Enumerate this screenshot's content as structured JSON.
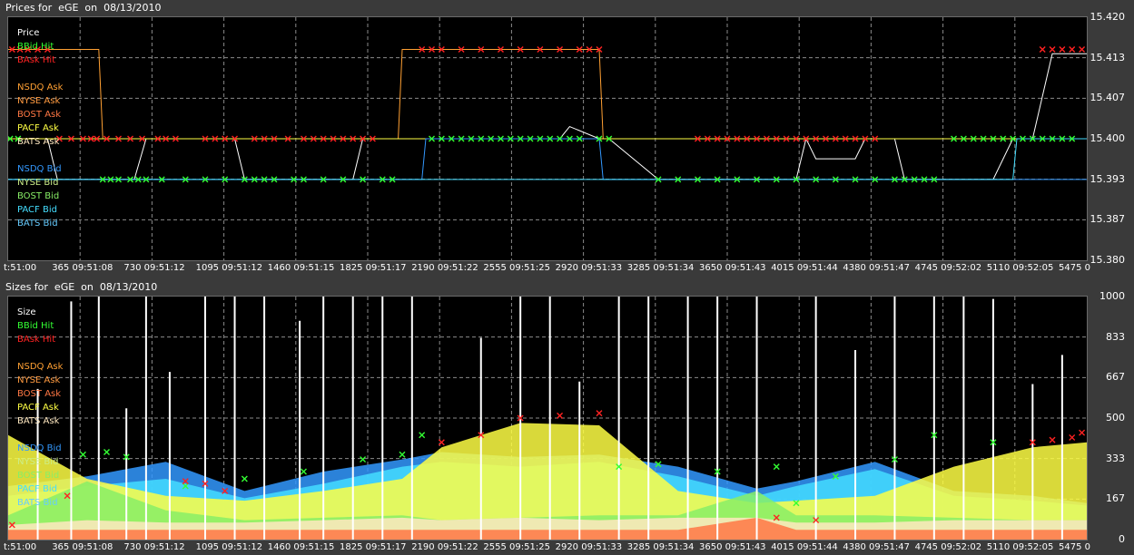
{
  "top": {
    "title": "Prices for  eGE  on  08/13/2010",
    "y_ticks": [
      "15.420",
      "15.413",
      "15.407",
      "15.400",
      "15.393",
      "15.387",
      "15.380"
    ],
    "x_ticks": [
      "t:51:00",
      "365 09:51:08",
      "730 09:51:12",
      "1095 09:51:12",
      "1460 09:51:15",
      "1825 09:51:17",
      "2190 09:51:22",
      "2555 09:51:25",
      "2920 09:51:33",
      "3285 09:51:34",
      "3650 09:51:43",
      "4015 09:51:44",
      "4380 09:51:47",
      "4745 09:52:02",
      "5110 09:52:05",
      "5475 0"
    ],
    "legend": [
      {
        "label": "Price",
        "color": "#ffffff"
      },
      {
        "label": "BBid Hit",
        "color": "#33ff33"
      },
      {
        "label": "BAsk Hit",
        "color": "#ff2222"
      },
      {
        "label": "",
        "color": ""
      },
      {
        "label": "NSDQ Ask",
        "color": "#ffa033"
      },
      {
        "label": "NYSE Ask",
        "color": "#ff9a40"
      },
      {
        "label": "BOST Ask",
        "color": "#ff7744"
      },
      {
        "label": "PACF Ask",
        "color": "#ffff44"
      },
      {
        "label": "BATS Ask",
        "color": "#ffe8c0"
      },
      {
        "label": "",
        "color": ""
      },
      {
        "label": "NSDQ Bid",
        "color": "#3399ff"
      },
      {
        "label": "NYSE Bid",
        "color": "#ccee88"
      },
      {
        "label": "BOST Bid",
        "color": "#88ee66"
      },
      {
        "label": "PACF Bid",
        "color": "#44ddff"
      },
      {
        "label": "BATS Bid",
        "color": "#66ccff"
      }
    ]
  },
  "bottom": {
    "title": "Sizes for  eGE  on  08/13/2010",
    "y_ticks": [
      "1000",
      "833",
      "667",
      "500",
      "333",
      "167",
      "0"
    ],
    "x_ticks": [
      "t:51:00",
      "365 09:51:08",
      "730 09:51:12",
      "1095 09:51:12",
      "1460 09:51:15",
      "1825 09:51:17",
      "2190 09:51:22",
      "2555 09:51:25",
      "2920 09:51:33",
      "3285 09:51:34",
      "3650 09:51:43",
      "4015 09:51:44",
      "4380 09:51:47",
      "4745 09:52:02",
      "5110 09:52:05",
      "5475 0"
    ],
    "legend": [
      {
        "label": "Size",
        "color": "#ffffff"
      },
      {
        "label": "BBid Hit",
        "color": "#33ff33"
      },
      {
        "label": "BAsk Hit",
        "color": "#ff2222"
      },
      {
        "label": "",
        "color": ""
      },
      {
        "label": "NSDQ Ask",
        "color": "#ffa033"
      },
      {
        "label": "NYSE Ask",
        "color": "#ff9a40"
      },
      {
        "label": "BOST Ask",
        "color": "#ff7744"
      },
      {
        "label": "PACF Ask",
        "color": "#ffff44"
      },
      {
        "label": "BATS Ask",
        "color": "#ffe8c0"
      },
      {
        "label": "",
        "color": ""
      },
      {
        "label": "NSDQ Bid",
        "color": "#3399ff"
      },
      {
        "label": "NYSE Bid",
        "color": "#ccee88"
      },
      {
        "label": "BOST Bid",
        "color": "#88ee66"
      },
      {
        "label": "PACF Bid",
        "color": "#44ddff"
      },
      {
        "label": "BATS Bid",
        "color": "#66ccff"
      }
    ]
  },
  "chart_data": [
    {
      "type": "line",
      "title": "Prices for  eGE  on  08/13/2010",
      "xlim": [
        0,
        5475
      ],
      "ylim": [
        15.38,
        15.42
      ],
      "grid": true,
      "legend_position": "top-left",
      "series": [
        {
          "name": "BAsk Hit",
          "color": "#ff2222",
          "marker": "x",
          "x": [
            20,
            60,
            100,
            150,
            200,
            260,
            320,
            380,
            420,
            450,
            500,
            560,
            620,
            680,
            760,
            800,
            850,
            1000,
            1050,
            1100,
            1150,
            1250,
            1300,
            1350,
            1420,
            1500,
            1550,
            1600,
            1650,
            1700,
            1750,
            1800,
            1850,
            2100,
            2150,
            2200,
            2300,
            2400,
            2500,
            2600,
            2700,
            2800,
            2900,
            2950,
            3000,
            3500,
            3550,
            3600,
            3650,
            3700,
            3750,
            3800,
            3850,
            3900,
            3950,
            4000,
            4050,
            4100,
            4150,
            4200,
            4250,
            4300,
            4350,
            4400,
            5250,
            5300,
            5350,
            5400,
            5450
          ],
          "y": [
            15.4147,
            15.4147,
            15.4147,
            15.4147,
            15.4147,
            15.4,
            15.4,
            15.4,
            15.4,
            15.4,
            15.4,
            15.4,
            15.4,
            15.4,
            15.4,
            15.4,
            15.4,
            15.4,
            15.4,
            15.4,
            15.4,
            15.4,
            15.4,
            15.4,
            15.4,
            15.4,
            15.4,
            15.4,
            15.4,
            15.4,
            15.4,
            15.4,
            15.4,
            15.4147,
            15.4147,
            15.4147,
            15.4147,
            15.4147,
            15.4147,
            15.4147,
            15.4147,
            15.4147,
            15.4147,
            15.4147,
            15.4147,
            15.4,
            15.4,
            15.4,
            15.4,
            15.4,
            15.4,
            15.4,
            15.4,
            15.4,
            15.4,
            15.4,
            15.4,
            15.4,
            15.4,
            15.4,
            15.4,
            15.4,
            15.4,
            15.4,
            15.4147,
            15.4147,
            15.4147,
            15.4147,
            15.4147
          ]
        },
        {
          "name": "BBid Hit",
          "color": "#33ff33",
          "marker": "x",
          "x": [
            10,
            50,
            480,
            520,
            560,
            620,
            660,
            700,
            780,
            900,
            1000,
            1100,
            1200,
            1250,
            1300,
            1350,
            1450,
            1500,
            1600,
            1700,
            1800,
            1900,
            1950,
            2150,
            2200,
            2250,
            2300,
            2350,
            2400,
            2450,
            2500,
            2550,
            2600,
            2650,
            2700,
            2750,
            2800,
            2850,
            2900,
            3000,
            3050,
            3300,
            3400,
            3500,
            3600,
            3700,
            3800,
            3900,
            4000,
            4100,
            4200,
            4300,
            4400,
            4500,
            4550,
            4600,
            4650,
            4700,
            4800,
            4850,
            4900,
            4950,
            5000,
            5050,
            5100,
            5150,
            5200,
            5250,
            5300,
            5350,
            5400
          ],
          "y": [
            15.4,
            15.4,
            15.3933,
            15.3933,
            15.3933,
            15.3933,
            15.3933,
            15.3933,
            15.3933,
            15.3933,
            15.3933,
            15.3933,
            15.3933,
            15.3933,
            15.3933,
            15.3933,
            15.3933,
            15.3933,
            15.3933,
            15.3933,
            15.3933,
            15.3933,
            15.3933,
            15.4,
            15.4,
            15.4,
            15.4,
            15.4,
            15.4,
            15.4,
            15.4,
            15.4,
            15.4,
            15.4,
            15.4,
            15.4,
            15.4,
            15.4,
            15.4,
            15.4,
            15.4,
            15.3933,
            15.3933,
            15.3933,
            15.3933,
            15.3933,
            15.3933,
            15.3933,
            15.3933,
            15.3933,
            15.3933,
            15.3933,
            15.3933,
            15.3933,
            15.3933,
            15.3933,
            15.3933,
            15.3933,
            15.4,
            15.4,
            15.4,
            15.4,
            15.4,
            15.4,
            15.4,
            15.4,
            15.4,
            15.4,
            15.4,
            15.4,
            15.4
          ]
        },
        {
          "name": "Price",
          "color": "#ffffff",
          "x": [
            0,
            200,
            250,
            640,
            700,
            1150,
            1200,
            1750,
            1800,
            2000,
            2200,
            2800,
            2850,
            3000,
            3050,
            3300,
            4000,
            4050,
            4100,
            4300,
            4350,
            4500,
            4550,
            5000,
            5100,
            5200,
            5300,
            5475
          ],
          "y": [
            15.4,
            15.4,
            15.3933,
            15.3933,
            15.4,
            15.4,
            15.3933,
            15.3933,
            15.4,
            15.4,
            15.4,
            15.4,
            15.402,
            15.4,
            15.4,
            15.3933,
            15.3933,
            15.4,
            15.3967,
            15.3967,
            15.4,
            15.4,
            15.3933,
            15.3933,
            15.4,
            15.4,
            15.414,
            15.414
          ]
        },
        {
          "name": "NSDQ Ask",
          "color": "#ffa033",
          "x": [
            0,
            460,
            480,
            1980,
            2000,
            3000,
            3020,
            5475
          ],
          "y": [
            15.4147,
            15.4147,
            15.4,
            15.4,
            15.4147,
            15.4147,
            15.4,
            15.4
          ]
        },
        {
          "name": "PACF Ask",
          "color": "#ffff44",
          "x": [
            0,
            5475
          ],
          "y": [
            15.4,
            15.4
          ]
        },
        {
          "name": "NSDQ Bid",
          "color": "#3399ff",
          "x": [
            0,
            2100,
            2120,
            3000,
            3020,
            5475
          ],
          "y": [
            15.3933,
            15.3933,
            15.4,
            15.4,
            15.3933,
            15.3933
          ]
        },
        {
          "name": "PACF Bid",
          "color": "#44ddff",
          "x": [
            0,
            5100,
            5120,
            5475
          ],
          "y": [
            15.3933,
            15.3933,
            15.4,
            15.4
          ]
        }
      ]
    },
    {
      "type": "area",
      "title": "Sizes for  eGE  on  08/13/2010",
      "xlim": [
        0,
        5475
      ],
      "ylim": [
        0,
        1000
      ],
      "grid": true,
      "legend_position": "top-left",
      "series": [
        {
          "name": "NSDQ Bid",
          "color": "#3399ff",
          "x": [
            0,
            400,
            800,
            1200,
            1600,
            2000,
            2200,
            2600,
            3000,
            3400,
            3800,
            4000,
            4400,
            4800,
            5200,
            5475
          ],
          "y": [
            220,
            260,
            320,
            200,
            280,
            330,
            360,
            340,
            350,
            300,
            210,
            240,
            320,
            200,
            180,
            150
          ]
        },
        {
          "name": "PACF Bid",
          "color": "#44ddff",
          "x": [
            0,
            400,
            800,
            1200,
            1600,
            2000,
            2200,
            2600,
            3000,
            3400,
            3800,
            4000,
            4400,
            4800,
            5200,
            5475
          ],
          "y": [
            180,
            220,
            250,
            170,
            230,
            300,
            320,
            300,
            320,
            260,
            180,
            220,
            290,
            180,
            160,
            140
          ]
        },
        {
          "name": "PACF Ask",
          "color": "#ffff44",
          "x": [
            0,
            400,
            800,
            1200,
            1600,
            2000,
            2200,
            2600,
            3000,
            3400,
            3800,
            4000,
            4400,
            4800,
            5200,
            5475
          ],
          "y": [
            430,
            250,
            180,
            160,
            200,
            250,
            380,
            480,
            470,
            200,
            150,
            160,
            180,
            300,
            380,
            400
          ]
        },
        {
          "name": "BOST Bid",
          "color": "#88ee66",
          "x": [
            0,
            400,
            800,
            1200,
            1600,
            2000,
            2200,
            2600,
            3000,
            3400,
            3800,
            4000,
            4400,
            4800,
            5200,
            5475
          ],
          "y": [
            100,
            240,
            120,
            80,
            90,
            100,
            80,
            90,
            100,
            100,
            200,
            100,
            100,
            90,
            80,
            80
          ]
        },
        {
          "name": "BATS Ask",
          "color": "#ffe8c0",
          "x": [
            0,
            400,
            800,
            1200,
            1600,
            2000,
            2200,
            2600,
            3000,
            3400,
            3800,
            4000,
            4400,
            4800,
            5200,
            5475
          ],
          "y": [
            60,
            80,
            70,
            70,
            80,
            90,
            80,
            90,
            80,
            90,
            90,
            70,
            70,
            80,
            80,
            80
          ]
        },
        {
          "name": "BOST Ask",
          "color": "#ff7744",
          "x": [
            0,
            400,
            800,
            1200,
            1600,
            2000,
            2200,
            2600,
            3000,
            3400,
            3800,
            4000,
            4400,
            4800,
            5200,
            5475
          ],
          "y": [
            40,
            40,
            40,
            40,
            40,
            40,
            40,
            40,
            40,
            40,
            90,
            40,
            40,
            40,
            40,
            40
          ]
        },
        {
          "name": "BBid Hit",
          "color": "#33ff33",
          "marker": "x",
          "x": [
            380,
            500,
            600,
            900,
            1200,
            1500,
            1800,
            2000,
            2100,
            3100,
            3300,
            3600,
            3900,
            4000,
            4200,
            4500,
            4700,
            5000
          ],
          "y": [
            350,
            360,
            340,
            220,
            250,
            280,
            330,
            350,
            430,
            300,
            310,
            280,
            300,
            150,
            260,
            330,
            430,
            400
          ]
        },
        {
          "name": "BAsk Hit",
          "color": "#ff2222",
          "marker": "x",
          "x": [
            20,
            300,
            900,
            1000,
            1100,
            2200,
            2400,
            2600,
            2800,
            3000,
            3900,
            4100,
            5200,
            5300,
            5400,
            5450
          ],
          "y": [
            60,
            180,
            240,
            230,
            200,
            400,
            430,
            500,
            510,
            520,
            90,
            80,
            400,
            410,
            420,
            440
          ]
        },
        {
          "name": "Size",
          "color": "#ffffff",
          "x": [
            150,
            320,
            460,
            600,
            700,
            820,
            1000,
            1150,
            1300,
            1480,
            1600,
            1750,
            1900,
            2050,
            2400,
            2600,
            2750,
            2900,
            3100,
            3250,
            3450,
            3600,
            3800,
            4100,
            4300,
            4500,
            4700,
            4850,
            5000,
            5200,
            5350
          ],
          "y": [
            620,
            980,
            1000,
            540,
            1000,
            690,
            1000,
            1000,
            1000,
            900,
            1000,
            1000,
            1000,
            1000,
            830,
            1000,
            1000,
            650,
            1000,
            1000,
            1000,
            1000,
            1000,
            1000,
            780,
            1000,
            1000,
            1000,
            990,
            640,
            760
          ]
        }
      ]
    }
  ]
}
